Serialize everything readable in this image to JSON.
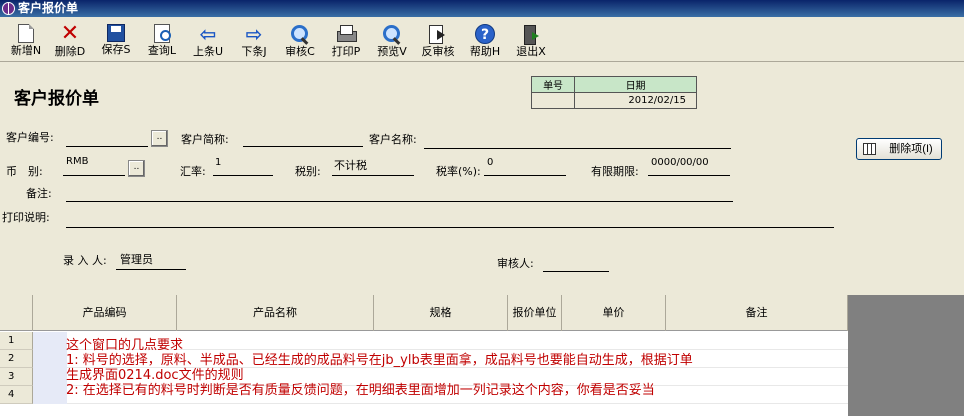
{
  "window": {
    "title": "客户报价单"
  },
  "toolbar": [
    {
      "name": "new-button",
      "icon": "new-doc-icon",
      "label": "新增N"
    },
    {
      "name": "delete-button",
      "icon": "delete-x-icon",
      "label": "删除D"
    },
    {
      "name": "save-button",
      "icon": "floppy-icon",
      "label": "保存S"
    },
    {
      "name": "query-button",
      "icon": "query-doc-icon",
      "label": "查询L"
    },
    {
      "name": "prev-button",
      "icon": "arrow-left-icon",
      "label": "上条U"
    },
    {
      "name": "next-button",
      "icon": "arrow-right-icon",
      "label": "下条J"
    },
    {
      "name": "audit-button",
      "icon": "magnifier-icon",
      "label": "审核C"
    },
    {
      "name": "print-button",
      "icon": "printer-icon",
      "label": "打印P"
    },
    {
      "name": "preview-button",
      "icon": "magnifier-icon",
      "label": "预览V"
    },
    {
      "name": "unaudit-button",
      "icon": "unaudit-icon",
      "label": "反审核"
    },
    {
      "name": "help-button",
      "icon": "help-icon",
      "label": "帮助H"
    },
    {
      "name": "exit-button",
      "icon": "exit-door-icon",
      "label": "退出X"
    }
  ],
  "form": {
    "heading": "客户报价单",
    "number_header": "单号",
    "number_value": "",
    "date_header": "日期",
    "date_value": "2012/02/15",
    "customer_code_label": "客户编号:",
    "customer_code_value": "",
    "customer_short_label": "客户简称:",
    "customer_short_value": "",
    "customer_name_label": "客户名称:",
    "customer_name_value": "",
    "currency_label": "币　别:",
    "currency_value": "RMB",
    "exchange_rate_label": "汇率:",
    "exchange_rate_value": "1",
    "tax_type_label": "税别:",
    "tax_type_value": "不计税",
    "tax_rate_label": "税率(%):",
    "tax_rate_value": "0",
    "valid_until_label": "有限期限:",
    "valid_until_value": "0000/00/00",
    "remarks_label": "备注:",
    "print_desc_label": "打印说明:",
    "entered_by_label": "录 入 人:",
    "entered_by_value": "管理员",
    "auditor_label": "审核人:",
    "auditor_value": "",
    "lookup_button": "..",
    "delete_item_button": "删除项(I)"
  },
  "grid": {
    "columns": [
      "",
      "产品编码",
      "产品名称",
      "规格",
      "报价单位",
      "单价",
      "备注"
    ],
    "row_numbers": [
      "1",
      "2",
      "3",
      "4"
    ]
  },
  "note": {
    "lines": [
      "这个窗口的几点要求",
      "1:  料号的选择，原料、半成品、已经生成的成品料号在jb_ylb表里面拿，成品料号也要能自动生成，根据订单",
      "生成界面0214.doc文件的规则",
      "2:  在选择已有的料号时判断是否有质量反馈问题，在明细表里面增加一列记录这个内容，你看是否妥当"
    ],
    "color": "#c00000"
  }
}
